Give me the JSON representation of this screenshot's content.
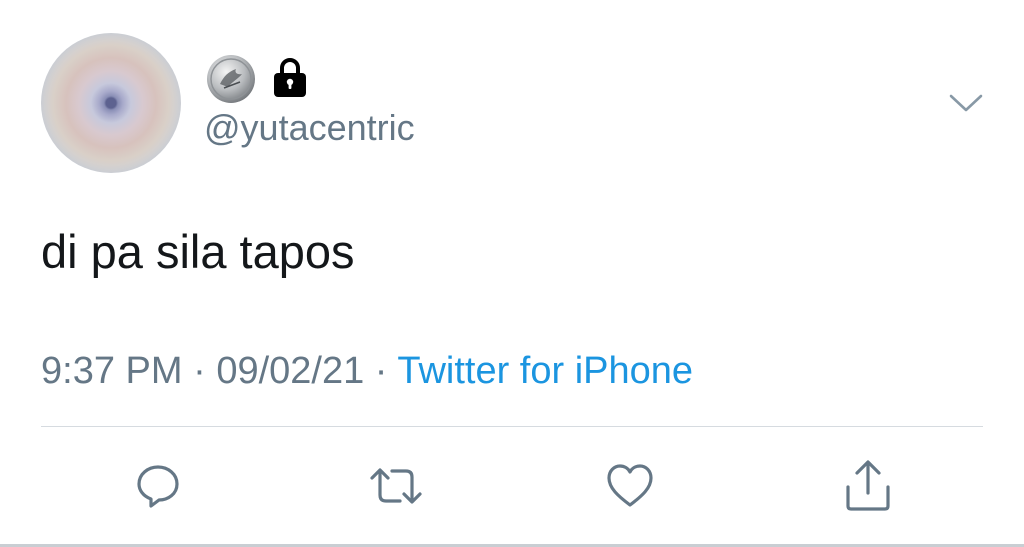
{
  "tweet": {
    "handle": "@yutacentric",
    "text": "di pa sila tapos",
    "time": "9:37 PM",
    "separator": "·",
    "date": "09/02/21",
    "source": "Twitter for iPhone"
  },
  "icons": {
    "name_emoji": "coin-icon",
    "protected": "lock-icon",
    "menu": "chevron-down-icon",
    "actions": [
      "reply-icon",
      "retweet-icon",
      "like-icon",
      "share-icon"
    ]
  },
  "colors": {
    "text": "#14171a",
    "secondary": "#657786",
    "link": "#1b95e0",
    "divider": "#d6dbe0"
  }
}
